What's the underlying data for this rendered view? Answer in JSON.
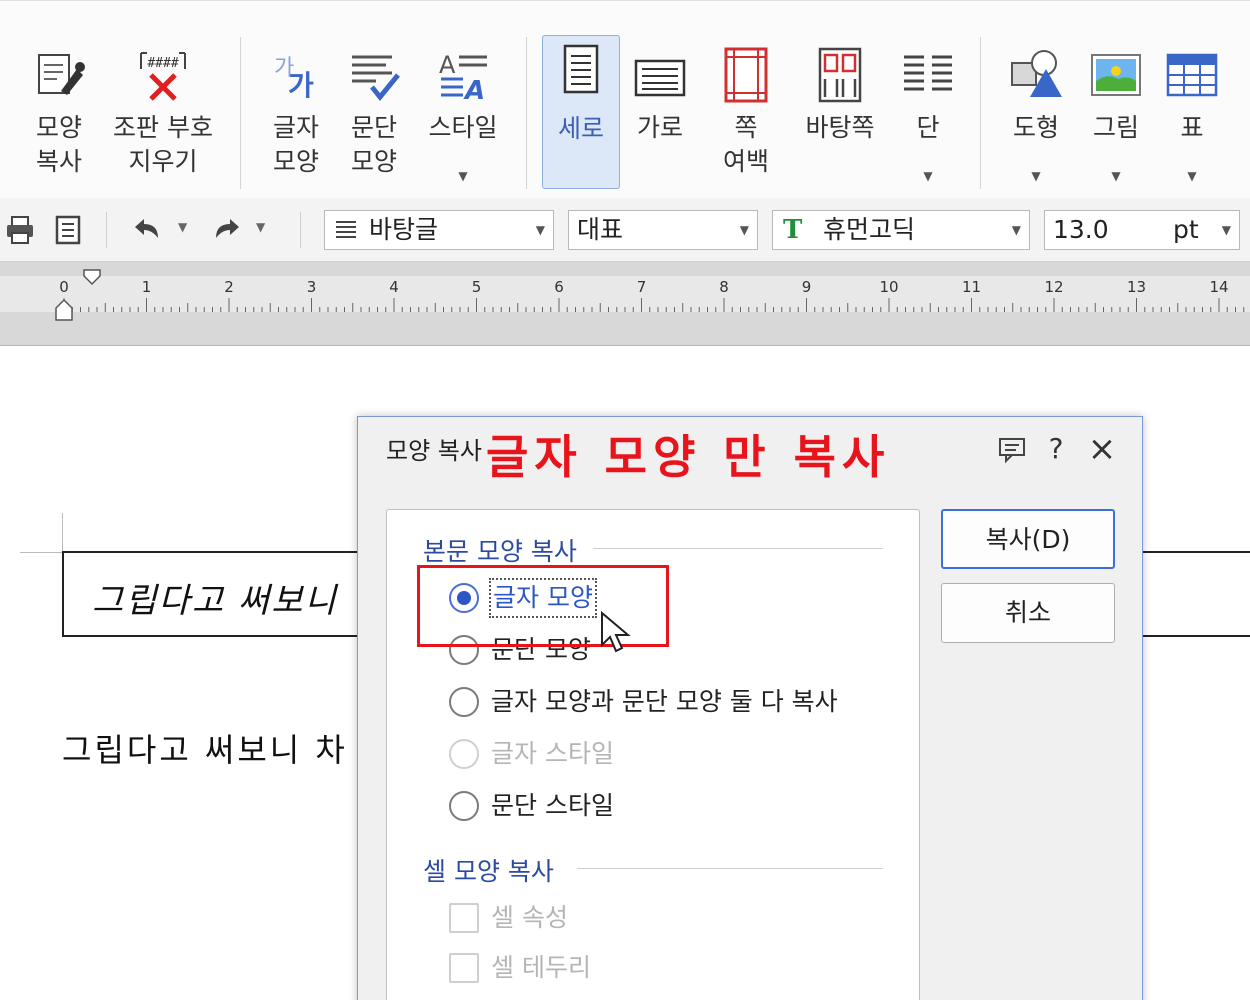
{
  "ribbon": {
    "items": [
      {
        "label1": "모양",
        "label2": "복사",
        "icon": "eyedropper-icon"
      },
      {
        "label1": "조판 부호",
        "label2": "지우기",
        "icon": "remove-markup-icon"
      },
      {
        "label1": "글자",
        "label2": "모양",
        "icon": "char-shape-icon"
      },
      {
        "label1": "문단",
        "label2": "모양",
        "icon": "para-shape-icon"
      },
      {
        "label1": "스타일",
        "label2": "",
        "icon": "style-icon"
      },
      {
        "label1": "세로",
        "label2": "",
        "icon": "portrait-page-icon"
      },
      {
        "label1": "가로",
        "label2": "",
        "icon": "landscape-page-icon"
      },
      {
        "label1": "쪽",
        "label2": "여백",
        "icon": "page-margin-icon"
      },
      {
        "label1": "바탕쪽",
        "label2": "",
        "icon": "master-page-icon"
      },
      {
        "label1": "단",
        "label2": "",
        "icon": "columns-icon"
      },
      {
        "label1": "도형",
        "label2": "",
        "icon": "shape-icon"
      },
      {
        "label1": "그림",
        "label2": "",
        "icon": "picture-icon"
      },
      {
        "label1": "표",
        "label2": "",
        "icon": "table-icon"
      }
    ]
  },
  "toolbar": {
    "style_value": "바탕글",
    "lang_value": "대표",
    "font_value": "휴먼고딕",
    "size_value": "13.0",
    "size_unit": "pt",
    "font_badge": "T"
  },
  "ruler": {
    "labels": [
      "0",
      "1",
      "2",
      "3",
      "4",
      "5",
      "6",
      "7",
      "8",
      "9",
      "10",
      "11",
      "12",
      "13",
      "14"
    ]
  },
  "document": {
    "cell_text": "그립다고 써보니",
    "body_text": "그립다고 써보니 차"
  },
  "dialog": {
    "title": "모양 복사",
    "annotation": "글자 모양 만 복사",
    "section1_title": "본문 모양 복사",
    "options": [
      {
        "label": "글자 모양",
        "state": "selected"
      },
      {
        "label": "문단 모양",
        "state": "normal"
      },
      {
        "label": "글자 모양과 문단 모양 둘 다 복사",
        "state": "normal"
      },
      {
        "label": "글자 스타일",
        "state": "disabled"
      },
      {
        "label": "문단 스타일",
        "state": "normal"
      }
    ],
    "section2_title": "셀 모양 복사",
    "cell_options": [
      {
        "label": "셀 속성",
        "state": "disabled"
      },
      {
        "label": "셀 테두리",
        "state": "disabled"
      }
    ],
    "copy_button": "복사(D)",
    "cancel_button": "취소",
    "help_label": "?",
    "close_label": "×"
  },
  "colors": {
    "accent": "#2c55c6",
    "annotation_red": "#e8141c",
    "selected_tab_bg": "#dce7f7"
  }
}
